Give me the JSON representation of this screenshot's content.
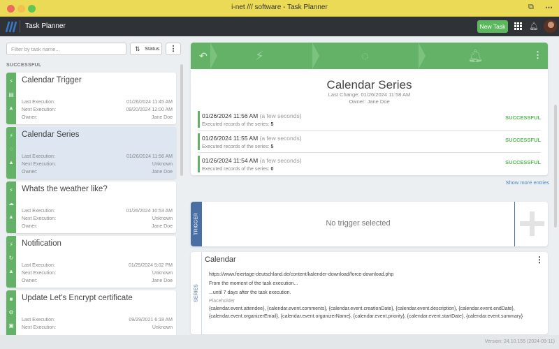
{
  "window": {
    "title": "i-net /// software - Task Planner"
  },
  "appbar": {
    "app_name": "Task Planner",
    "new_task_label": "New Task"
  },
  "left": {
    "filter_placeholder": "Filter by task name...",
    "status_label": "Status",
    "section_label": "SUCCESSFUL",
    "tasks": [
      {
        "title": "Calendar Trigger",
        "last_label": "Last Execution:",
        "last": "01/26/2024 11:45 AM",
        "next_label": "Next Execution:",
        "next": "09/20/2024 12:00 AM",
        "owner_label": "Owner:",
        "owner": "Jane Doe"
      },
      {
        "title": "Calendar Series",
        "last_label": "Last Execution:",
        "last": "01/26/2024 11:56 AM",
        "next_label": "Next Execution:",
        "next": "Unknown",
        "owner_label": "Owner:",
        "owner": "Jane Doe"
      },
      {
        "title": "Whats the weather like?",
        "last_label": "Last Execution:",
        "last": "01/26/2024 10:53 AM",
        "next_label": "Next Execution:",
        "next": "Unknown",
        "owner_label": "Owner:",
        "owner": "Jane Doe"
      },
      {
        "title": "Notification",
        "last_label": "Last Execution:",
        "last": "01/25/2024 5:02 PM",
        "next_label": "Next Execution:",
        "next": "Unknown",
        "owner_label": "Owner:",
        "owner": "Jane Doe"
      },
      {
        "title": "Update Let's Encrypt certificate",
        "last_label": "Last Execution:",
        "last": "09/29/2021 6:18 AM",
        "next_label": "Next Execution:",
        "next": "Unknown",
        "owner_label": "Owner:",
        "owner": ""
      }
    ]
  },
  "detail": {
    "title": "Calendar Series",
    "last_change": "Last Change: 01/26/2024 11:58 AM",
    "owner": "Owner: Jane Doe",
    "executions": [
      {
        "time": "01/26/2024 11:56 AM",
        "ago": "(a few seconds)",
        "detail_label": "Executed records of the series:",
        "count": "5",
        "status": "SUCCESSFUL"
      },
      {
        "time": "01/26/2024 11:55 AM",
        "ago": "(a few seconds)",
        "detail_label": "Executed records of the series:",
        "count": "5",
        "status": "SUCCESSFUL"
      },
      {
        "time": "01/26/2024 11:54 AM",
        "ago": "(a few seconds)",
        "detail_label": "Executed records of the series:",
        "count": "0",
        "status": "SUCCESSFUL"
      }
    ],
    "show_more": "Show more entries"
  },
  "trigger": {
    "label": "TRIGGER",
    "empty": "No trigger selected"
  },
  "series": {
    "label": "SERIES",
    "title": "Calendar",
    "url": "https://www.feiertage-deutschland.de/content/kalender-download/force-download.php",
    "from": "From the moment of the task execution...",
    "until": "...until 7 days after the task execution.",
    "placeholder_label": "Placeholder",
    "placeholders": "{calendar.event.attendee}, {calendar.event.comments}, {calendar.event.creationDate}, {calendar.event.description}, {calendar.event.endDate}, {calendar.event.organizerEmail}, {calendar.event.organizerName}, {calendar.event.priority}, {calendar.event.startDate}, {calendar.event.summary}"
  },
  "footer": {
    "version": "Version: 24.10.155 (2024-09-11)"
  },
  "colors": {
    "titlebar": "#ebda56",
    "appbar": "#2f3237",
    "success": "#63b267",
    "accent": "#4a6fa5"
  }
}
